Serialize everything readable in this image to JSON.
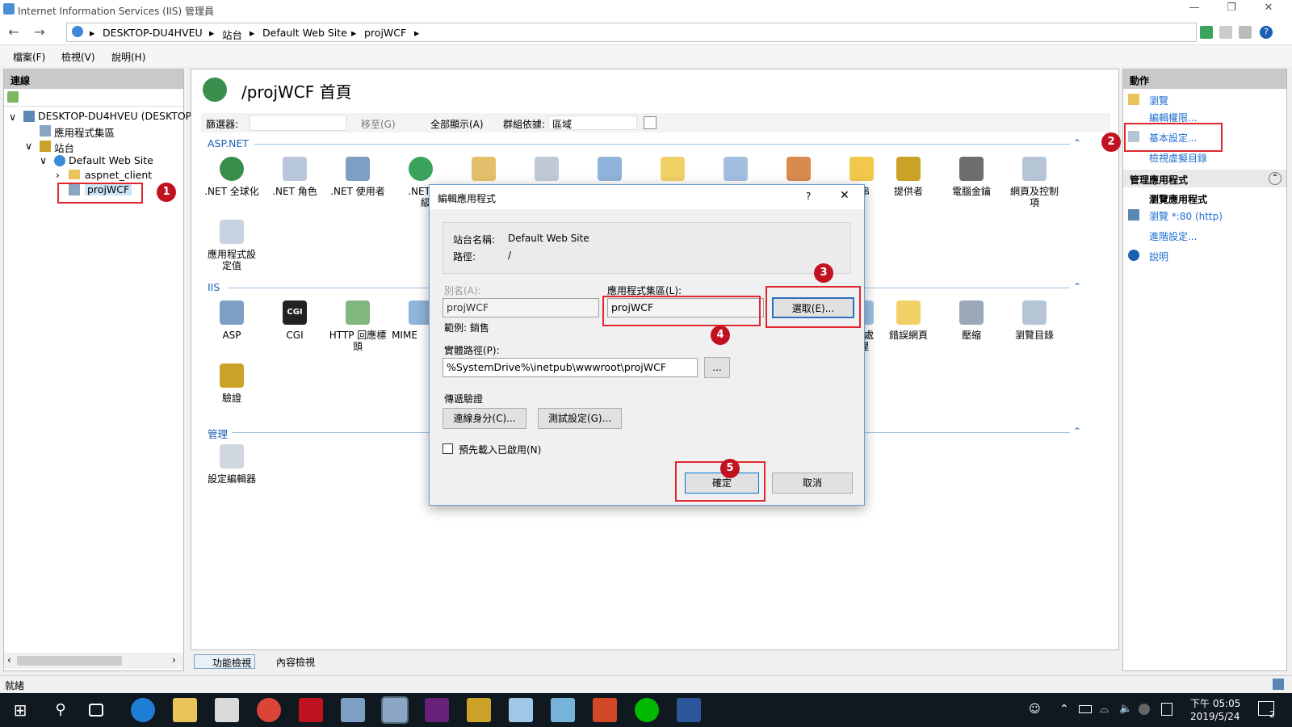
{
  "window": {
    "title": "Internet Information Services (IIS) 管理員"
  },
  "address": {
    "crumbs": [
      "DESKTOP-DU4HVEU",
      "站台",
      "Default Web Site",
      "projWCF"
    ]
  },
  "menu": [
    "檔案(F)",
    "檢視(V)",
    "說明(H)"
  ],
  "left": {
    "header": "連線",
    "tree": [
      "DESKTOP-DU4HVEU (DESKTOP",
      "應用程式集區",
      "站台",
      "Default Web Site",
      "aspnet_client",
      "projWCF"
    ]
  },
  "center": {
    "title": "/projWCF 首頁",
    "filter_label": "篩選器:",
    "goto": "移至(G)",
    "showall": "全部顯示(A)",
    "groupby_label": "群組依據:",
    "groupby_value": "區域",
    "groups": {
      "aspnet": "ASP.NET",
      "iis": "IIS",
      "manage": "管理"
    },
    "aspnet_items": [
      ".NET 全球化",
      ".NET 角色",
      ".NET 使用者",
      ".NET 信\n級",
      "",
      "",
      "",
      "",
      "",
      "字串",
      "提供者",
      "電腦金鑰",
      "網頁及控制\n項",
      "應用程式設\n定值"
    ],
    "iis_items": [
      "ASP",
      "CGI",
      "HTTP 回應標\n頭",
      "MIME",
      "取處\n理",
      "錯誤網頁",
      "壓縮",
      "瀏覽目錄",
      "驗證"
    ],
    "manage_items": [
      "設定編輯器"
    ],
    "tabs": [
      "功能檢視",
      "內容檢視"
    ]
  },
  "right": {
    "header": "動作",
    "actions": [
      "瀏覽",
      "編輯權限...",
      "基本設定...",
      "檢視虛擬目錄"
    ],
    "manage_header": "管理應用程式",
    "browse_header": "瀏覽應用程式",
    "browse_link": "瀏覽 *:80 (http)",
    "advanced": "進階設定...",
    "help": "說明"
  },
  "dialog": {
    "title": "編輯應用程式",
    "help": "?",
    "site_label": "站台名稱:",
    "site_value": "Default Web Site",
    "path_label": "路徑:",
    "path_value": "/",
    "alias_label": "別名(A):",
    "alias_value": "projWCF",
    "alias_example": "範例: 銷售",
    "pool_label": "應用程式集區(L):",
    "pool_value": "projWCF",
    "select_btn": "選取(E)...",
    "physical_label": "實體路徑(P):",
    "physical_value": "%SystemDrive%\\inetpub\\wwwroot\\projWCF",
    "browse_btn": "...",
    "passthrough_label": "傳遞驗證",
    "connect_btn": "連線身分(C)...",
    "test_btn": "測試設定(G)...",
    "preload_label": "預先載入已啟用(N)",
    "preload_checked": false,
    "ok_btn": "確定",
    "cancel_btn": "取消"
  },
  "markers": [
    "1",
    "2",
    "3",
    "4",
    "5"
  ],
  "status": {
    "text": "就緒"
  },
  "clock": {
    "time": "下午 05:05",
    "date": "2019/5/24"
  },
  "notif_count": "2"
}
